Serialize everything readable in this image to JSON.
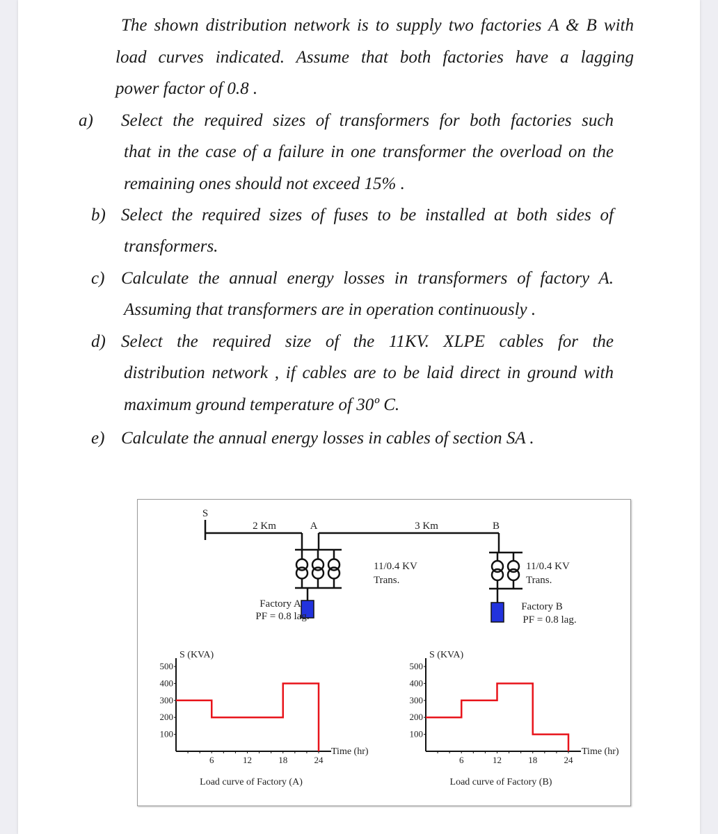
{
  "problem": {
    "intro": [
      "The shown distribution network is to supply two factories A & B with",
      "load curves indicated. Assume that both factories have a lagging",
      "power factor of 0.8 ."
    ],
    "parts": [
      {
        "label": "a)",
        "lines": [
          "Select the required sizes of transformers for both factories such",
          "that in the case of a failure in one transformer the overload on the",
          "remaining ones should not exceed 15% ."
        ]
      },
      {
        "label": "b)",
        "lines": [
          "Select the required sizes of fuses to be installed at both sides of",
          "transformers."
        ]
      },
      {
        "label": "c)",
        "lines": [
          "Calculate the annual energy losses in transformers of factory A.",
          "Assuming that transformers are in operation continuously ."
        ]
      },
      {
        "label": "d)",
        "lines": [
          "Select the required size of the 11KV. XLPE cables for the",
          "distribution network , if cables are to be laid direct in ground with",
          "maximum ground temperature of 30º C."
        ]
      },
      {
        "label": "e)",
        "lines": [
          "Calculate the annual energy losses in cables of section SA ."
        ]
      }
    ]
  },
  "diagram": {
    "node_s": "S",
    "node_a": "A",
    "node_b": "B",
    "dist_sa": "2 Km",
    "dist_ab": "3 Km",
    "trans_a_label_1": "11/0.4 KV",
    "trans_a_label_2": "Trans.",
    "trans_b_label_1": "11/0.4 KV",
    "trans_b_label_2": "Trans.",
    "factory_a_name": "Factory A",
    "factory_a_pf": "PF = 0.8 lag.",
    "factory_b_name": "Factory B",
    "factory_b_pf": "PF = 0.8 lag.",
    "transformers_a": 3,
    "transformers_b": 2,
    "load_color": "#2233dd"
  },
  "chart_data": [
    {
      "type": "line",
      "step": true,
      "title": "Load curve of Factory (A)",
      "xlabel": "Time (hr)",
      "ylabel": "S (KVA)",
      "x_ticks": [
        6,
        12,
        18,
        24
      ],
      "y_ticks": [
        100,
        200,
        300,
        400,
        500
      ],
      "xlim": [
        0,
        24
      ],
      "ylim": [
        0,
        500
      ],
      "segments": [
        {
          "from": 0,
          "to": 6,
          "value": 300
        },
        {
          "from": 6,
          "to": 18,
          "value": 200
        },
        {
          "from": 18,
          "to": 24,
          "value": 400
        }
      ],
      "color": "#e8141b"
    },
    {
      "type": "line",
      "step": true,
      "title": "Load curve of Factory (B)",
      "xlabel": "Time (hr)",
      "ylabel": "S (KVA)",
      "x_ticks": [
        6,
        12,
        18,
        24
      ],
      "y_ticks": [
        100,
        200,
        300,
        400,
        500
      ],
      "xlim": [
        0,
        24
      ],
      "ylim": [
        0,
        500
      ],
      "segments": [
        {
          "from": 0,
          "to": 6,
          "value": 200
        },
        {
          "from": 6,
          "to": 12,
          "value": 300
        },
        {
          "from": 12,
          "to": 18,
          "value": 400
        },
        {
          "from": 18,
          "to": 24,
          "value": 100
        }
      ],
      "color": "#e8141b"
    }
  ]
}
